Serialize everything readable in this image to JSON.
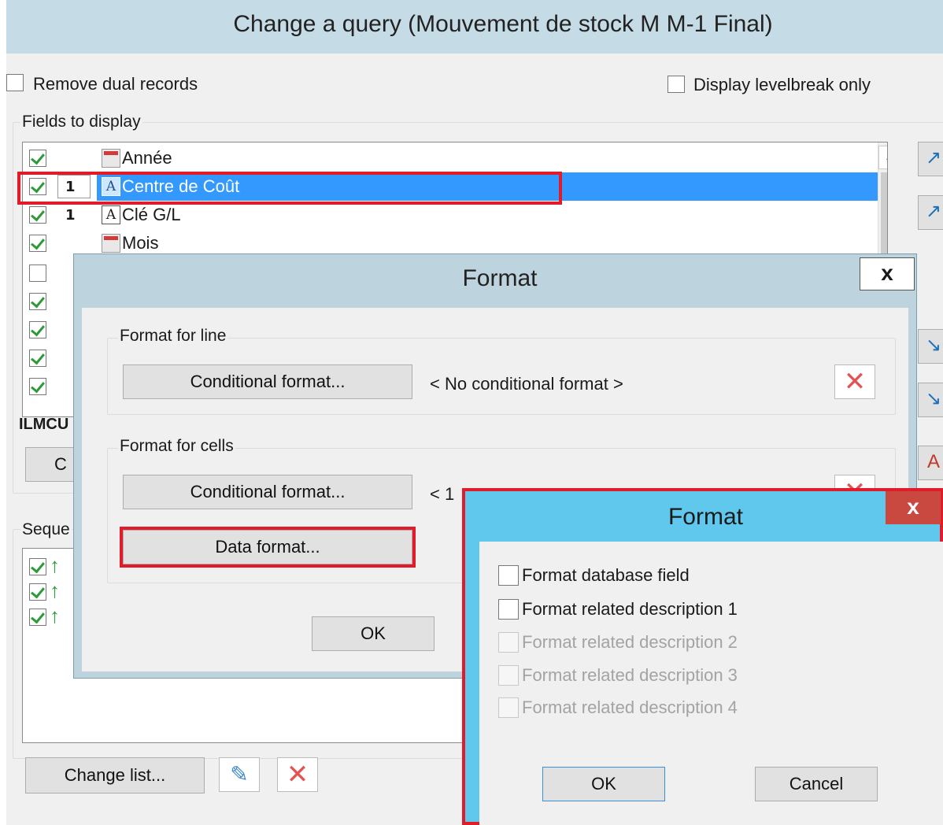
{
  "window": {
    "title": "Change a query (Mouvement de stock M M-1 Final)"
  },
  "options": {
    "remove_dual_records": "Remove dual records",
    "display_levelbreak_only": "Display levelbreak only"
  },
  "fields_section": {
    "label": "Fields to display",
    "rows": [
      {
        "checked": true,
        "num": "",
        "icon": "date-field-icon",
        "label": "Année"
      },
      {
        "checked": true,
        "num": "1",
        "icon": "text-field-icon",
        "label": "Centre de Coût",
        "selected": true
      },
      {
        "checked": true,
        "num": "1",
        "icon": "text-field-icon",
        "label": "Clé G/L"
      },
      {
        "checked": true,
        "num": "",
        "icon": "date-field-icon",
        "label": "Mois"
      },
      {
        "checked": false,
        "num": "",
        "icon": "",
        "label": ""
      },
      {
        "checked": true,
        "num": "",
        "icon": "",
        "label": ""
      },
      {
        "checked": true,
        "num": "",
        "icon": "",
        "label": ""
      },
      {
        "checked": true,
        "num": "",
        "icon": "",
        "label": ""
      },
      {
        "checked": true,
        "num": "",
        "icon": "",
        "label": ""
      }
    ],
    "field_code": "ILMCU",
    "c_button": "C"
  },
  "sequence_section": {
    "label": "Seque"
  },
  "bottom": {
    "change_list_button": "Change list..."
  },
  "format_dialog": {
    "title": "Format",
    "close_label": "x",
    "line_group": {
      "label": "Format for line",
      "conditional_button": "Conditional format...",
      "status": "< No conditional format >"
    },
    "cells_group": {
      "label": "Format for cells",
      "conditional_button": "Conditional format...",
      "status": "< 1",
      "data_format_button": "Data format..."
    },
    "ok_button": "OK"
  },
  "data_format_dialog": {
    "title": "Format",
    "close_label": "x",
    "options": [
      {
        "label": "Format database field",
        "enabled": true
      },
      {
        "label": "Format related description 1",
        "enabled": true
      },
      {
        "label": "Format related description 2",
        "enabled": false
      },
      {
        "label": "Format related description 3",
        "enabled": false
      },
      {
        "label": "Format related description 4",
        "enabled": false
      }
    ],
    "ok_button": "OK",
    "cancel_button": "Cancel"
  },
  "colors": {
    "highlight": "#e21b2a",
    "selection": "#3399ff",
    "title_bar": "#c5dbe6",
    "dialog_title": "#5fc8ec"
  }
}
